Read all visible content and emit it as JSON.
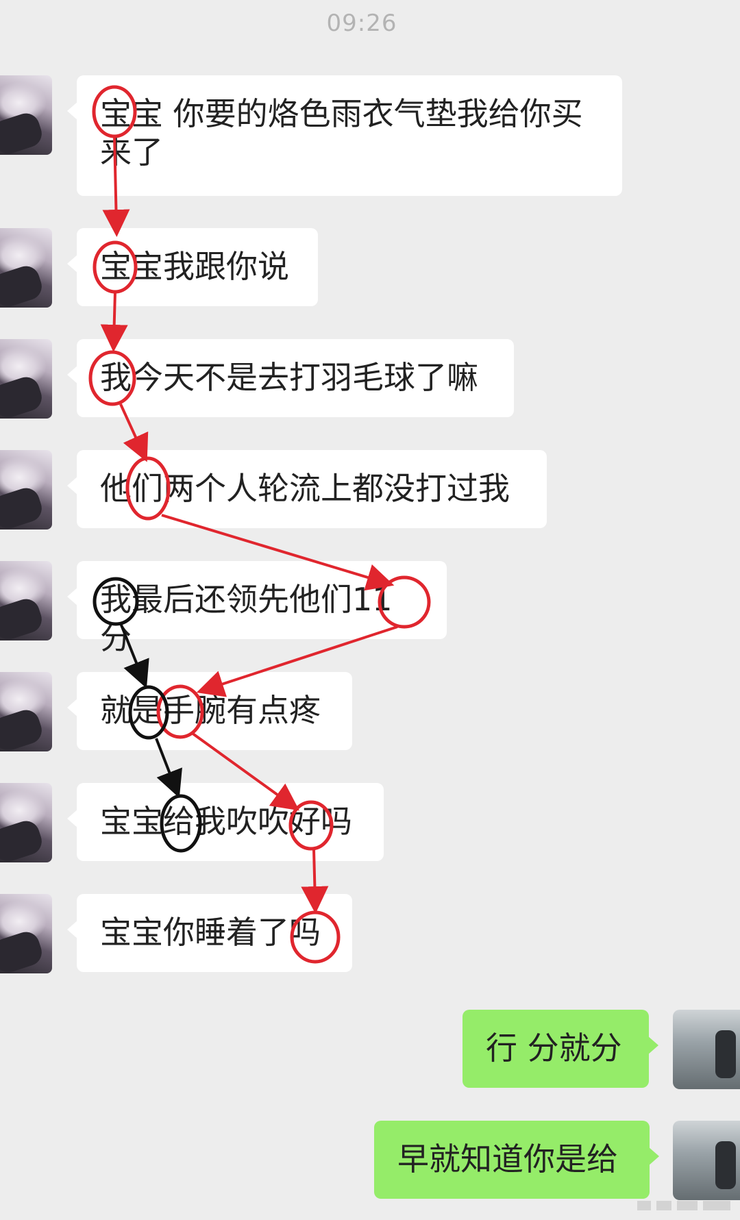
{
  "chat": {
    "timestamp": "09:26",
    "received_messages": [
      {
        "text": "宝宝 你要的烙色雨衣气垫我给你买来了"
      },
      {
        "text": "宝宝我跟你说"
      },
      {
        "text": "我今天不是去打羽毛球了嘛"
      },
      {
        "text": "他们两个人轮流上都没打过我"
      },
      {
        "text": "我最后还领先他们11分"
      },
      {
        "text": "就是手腕有点疼"
      },
      {
        "text": "宝宝给我吹吹好吗"
      },
      {
        "text": "宝宝你睡着了吗"
      }
    ],
    "sent_messages": [
      {
        "text": "行 分就分"
      },
      {
        "text": "早就知道你是给"
      }
    ]
  },
  "annotations": {
    "red_color": "#e0262e",
    "black_color": "#111111",
    "red_circled_chars": [
      "宝",
      "宝",
      "我",
      "们",
      "分",
      "手",
      "好",
      "吗"
    ],
    "black_circled_chars": [
      "我",
      "是",
      "给"
    ]
  },
  "colors": {
    "background": "#ededed",
    "received_bubble": "#ffffff",
    "sent_bubble": "#95ec69"
  }
}
